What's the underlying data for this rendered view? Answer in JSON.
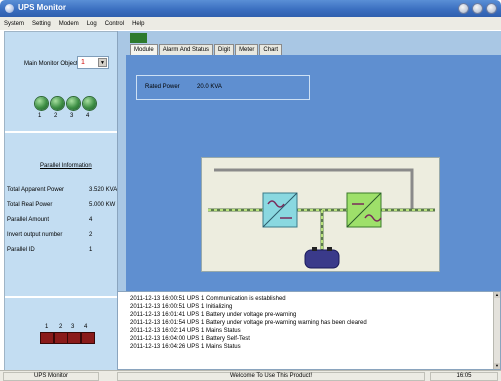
{
  "window": {
    "title": "UPS Monitor"
  },
  "menu": [
    "System",
    "Setting",
    "Modem",
    "Log",
    "Control",
    "Help"
  ],
  "left_panel": {
    "main_monitor_label": "Main Monitor Object:",
    "main_monitor_value": "1",
    "units": [
      "1",
      "2",
      "3",
      "4"
    ],
    "parallel_title": "Parallel Information",
    "parallel_rows": [
      {
        "label": "Total Apparent Power",
        "value": "3.520  KVA"
      },
      {
        "label": "Total Real Power",
        "value": "5.000  KW"
      },
      {
        "label": "Parallel Amount",
        "value": "4"
      },
      {
        "label": "Invert output number",
        "value": "2"
      },
      {
        "label": "Parallel ID",
        "value": "1"
      }
    ],
    "blocks": [
      "1",
      "2",
      "3",
      "4"
    ]
  },
  "tabs": [
    "Module",
    "Alarm And Status",
    "Digit",
    "Meter",
    "Chart"
  ],
  "active_tab": "Module",
  "module": {
    "rated_label": "Rated Power",
    "rated_value": "20.0 KVA"
  },
  "log": [
    "2011-12-13 16:00:51  UPS 1   Communication is established",
    "2011-12-13 16:00:51  UPS 1   Initializing",
    "2011-12-13 16:01:41  UPS 1   Battery under voltage pre-warning",
    "2011-12-13 16:01:54  UPS 1   Battery under voltage pre-warning warning has been cleared",
    "2011-12-13 16:02:14  UPS 1   Mains Status",
    "2011-12-13 16:04:00  UPS 1   Battery Self-Test",
    "2011-12-13 16:04:26  UPS 1   Mains Status"
  ],
  "statusbar": {
    "left": "UPS Monitor",
    "center": "Welcome To Use This Product!",
    "right": "16:05"
  },
  "colors": {
    "title_bar": "#3b6fc0",
    "panel": "#c3ddf2",
    "content": "#5f8fd0",
    "led": "#3e8f45",
    "block": "#8a1a1a",
    "power_flow": "#8ccf5a"
  }
}
